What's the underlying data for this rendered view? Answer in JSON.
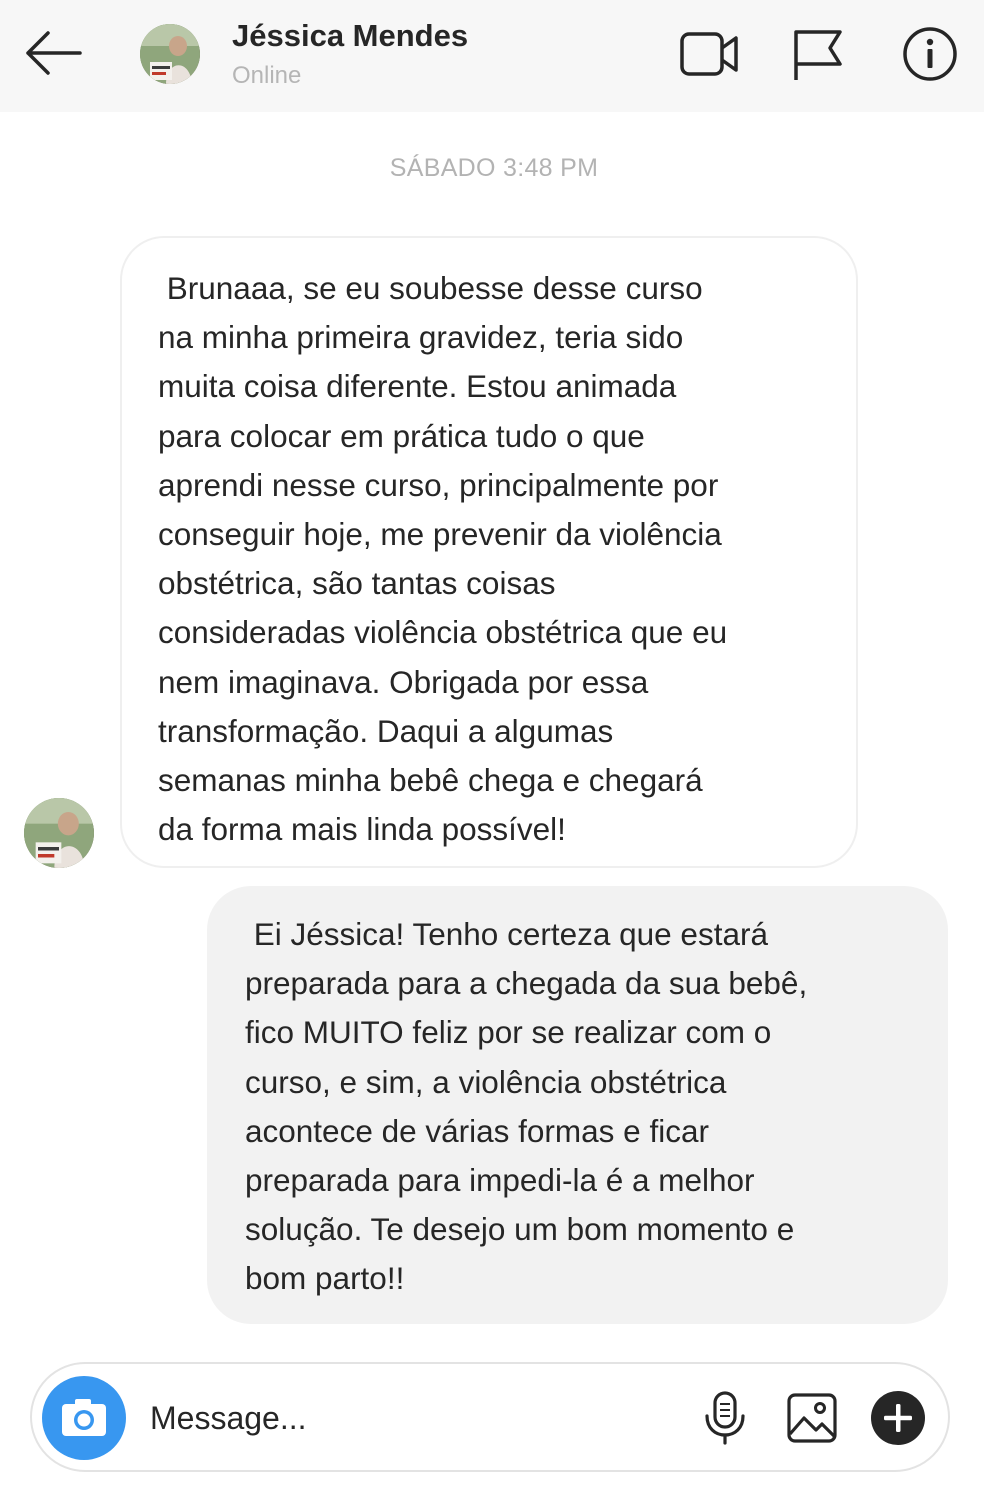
{
  "header": {
    "contact_name": "Jéssica Mendes",
    "status": "Online",
    "icons": [
      "back-arrow-icon",
      "video-camera-icon",
      "flag-icon",
      "info-icon"
    ]
  },
  "conversation": {
    "timestamp": "SÁBADO 3:48 PM",
    "messages": [
      {
        "sender": "Jéssica Mendes",
        "direction": "received",
        "text": " Brunaaa, se eu soubesse desse curso\nna minha primeira gravidez, teria sido\nmuita coisa diferente. Estou animada\npara colocar em prática tudo o que\naprendi nesse curso, principalmente por\nconseguir hoje, me prevenir da violência\nobstétrica, são tantas coisas\nconsideradas violência obstétrica que eu\nnem imaginava. Obrigada por essa\ntransformação. Daqui a algumas\nsemanas minha bebê chega e chegará\nda forma mais linda possível!"
      },
      {
        "direction": "sent",
        "text": " Ei Jéssica! Tenho certeza que estará\npreparada para a chegada da sua bebê,\nfico MUITO feliz por se realizar com o\ncurso, e sim, a violência obstétrica\nacontece de várias formas e ficar\npreparada para impedi-la é a melhor\nsolução. Te desejo um bom momento e\nbom parto!!"
      }
    ]
  },
  "composer": {
    "placeholder": "Message...",
    "value": "",
    "icons": [
      "camera-icon",
      "microphone-icon",
      "image-icon",
      "plus-icon"
    ]
  },
  "colors": {
    "header_bg": "#f7f7f7",
    "sent_bubble_bg": "#f2f2f2",
    "received_bubble_border": "#efefef",
    "camera_button": "#3897f0",
    "muted_text": "#b3b3b3"
  }
}
